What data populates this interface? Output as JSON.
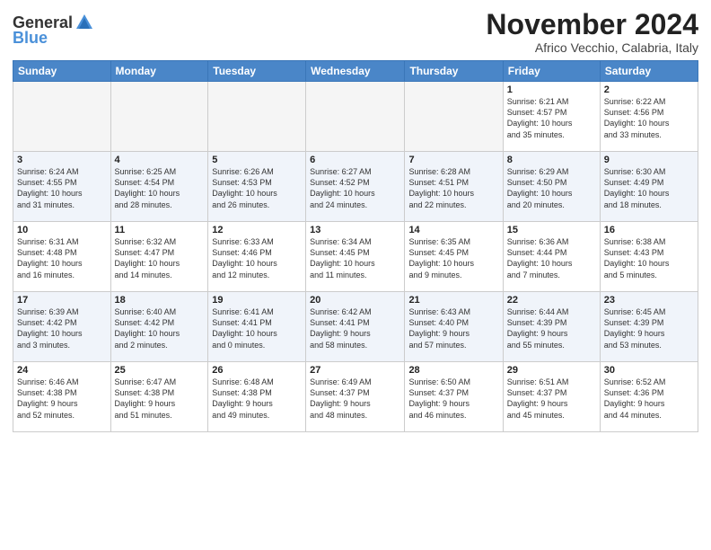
{
  "logo": {
    "general": "General",
    "blue": "Blue"
  },
  "title": "November 2024",
  "location": "Africo Vecchio, Calabria, Italy",
  "weekdays": [
    "Sunday",
    "Monday",
    "Tuesday",
    "Wednesday",
    "Thursday",
    "Friday",
    "Saturday"
  ],
  "weeks": [
    [
      {
        "day": "",
        "info": ""
      },
      {
        "day": "",
        "info": ""
      },
      {
        "day": "",
        "info": ""
      },
      {
        "day": "",
        "info": ""
      },
      {
        "day": "",
        "info": ""
      },
      {
        "day": "1",
        "info": "Sunrise: 6:21 AM\nSunset: 4:57 PM\nDaylight: 10 hours\nand 35 minutes."
      },
      {
        "day": "2",
        "info": "Sunrise: 6:22 AM\nSunset: 4:56 PM\nDaylight: 10 hours\nand 33 minutes."
      }
    ],
    [
      {
        "day": "3",
        "info": "Sunrise: 6:24 AM\nSunset: 4:55 PM\nDaylight: 10 hours\nand 31 minutes."
      },
      {
        "day": "4",
        "info": "Sunrise: 6:25 AM\nSunset: 4:54 PM\nDaylight: 10 hours\nand 28 minutes."
      },
      {
        "day": "5",
        "info": "Sunrise: 6:26 AM\nSunset: 4:53 PM\nDaylight: 10 hours\nand 26 minutes."
      },
      {
        "day": "6",
        "info": "Sunrise: 6:27 AM\nSunset: 4:52 PM\nDaylight: 10 hours\nand 24 minutes."
      },
      {
        "day": "7",
        "info": "Sunrise: 6:28 AM\nSunset: 4:51 PM\nDaylight: 10 hours\nand 22 minutes."
      },
      {
        "day": "8",
        "info": "Sunrise: 6:29 AM\nSunset: 4:50 PM\nDaylight: 10 hours\nand 20 minutes."
      },
      {
        "day": "9",
        "info": "Sunrise: 6:30 AM\nSunset: 4:49 PM\nDaylight: 10 hours\nand 18 minutes."
      }
    ],
    [
      {
        "day": "10",
        "info": "Sunrise: 6:31 AM\nSunset: 4:48 PM\nDaylight: 10 hours\nand 16 minutes."
      },
      {
        "day": "11",
        "info": "Sunrise: 6:32 AM\nSunset: 4:47 PM\nDaylight: 10 hours\nand 14 minutes."
      },
      {
        "day": "12",
        "info": "Sunrise: 6:33 AM\nSunset: 4:46 PM\nDaylight: 10 hours\nand 12 minutes."
      },
      {
        "day": "13",
        "info": "Sunrise: 6:34 AM\nSunset: 4:45 PM\nDaylight: 10 hours\nand 11 minutes."
      },
      {
        "day": "14",
        "info": "Sunrise: 6:35 AM\nSunset: 4:45 PM\nDaylight: 10 hours\nand 9 minutes."
      },
      {
        "day": "15",
        "info": "Sunrise: 6:36 AM\nSunset: 4:44 PM\nDaylight: 10 hours\nand 7 minutes."
      },
      {
        "day": "16",
        "info": "Sunrise: 6:38 AM\nSunset: 4:43 PM\nDaylight: 10 hours\nand 5 minutes."
      }
    ],
    [
      {
        "day": "17",
        "info": "Sunrise: 6:39 AM\nSunset: 4:42 PM\nDaylight: 10 hours\nand 3 minutes."
      },
      {
        "day": "18",
        "info": "Sunrise: 6:40 AM\nSunset: 4:42 PM\nDaylight: 10 hours\nand 2 minutes."
      },
      {
        "day": "19",
        "info": "Sunrise: 6:41 AM\nSunset: 4:41 PM\nDaylight: 10 hours\nand 0 minutes."
      },
      {
        "day": "20",
        "info": "Sunrise: 6:42 AM\nSunset: 4:41 PM\nDaylight: 9 hours\nand 58 minutes."
      },
      {
        "day": "21",
        "info": "Sunrise: 6:43 AM\nSunset: 4:40 PM\nDaylight: 9 hours\nand 57 minutes."
      },
      {
        "day": "22",
        "info": "Sunrise: 6:44 AM\nSunset: 4:39 PM\nDaylight: 9 hours\nand 55 minutes."
      },
      {
        "day": "23",
        "info": "Sunrise: 6:45 AM\nSunset: 4:39 PM\nDaylight: 9 hours\nand 53 minutes."
      }
    ],
    [
      {
        "day": "24",
        "info": "Sunrise: 6:46 AM\nSunset: 4:38 PM\nDaylight: 9 hours\nand 52 minutes."
      },
      {
        "day": "25",
        "info": "Sunrise: 6:47 AM\nSunset: 4:38 PM\nDaylight: 9 hours\nand 51 minutes."
      },
      {
        "day": "26",
        "info": "Sunrise: 6:48 AM\nSunset: 4:38 PM\nDaylight: 9 hours\nand 49 minutes."
      },
      {
        "day": "27",
        "info": "Sunrise: 6:49 AM\nSunset: 4:37 PM\nDaylight: 9 hours\nand 48 minutes."
      },
      {
        "day": "28",
        "info": "Sunrise: 6:50 AM\nSunset: 4:37 PM\nDaylight: 9 hours\nand 46 minutes."
      },
      {
        "day": "29",
        "info": "Sunrise: 6:51 AM\nSunset: 4:37 PM\nDaylight: 9 hours\nand 45 minutes."
      },
      {
        "day": "30",
        "info": "Sunrise: 6:52 AM\nSunset: 4:36 PM\nDaylight: 9 hours\nand 44 minutes."
      }
    ]
  ]
}
